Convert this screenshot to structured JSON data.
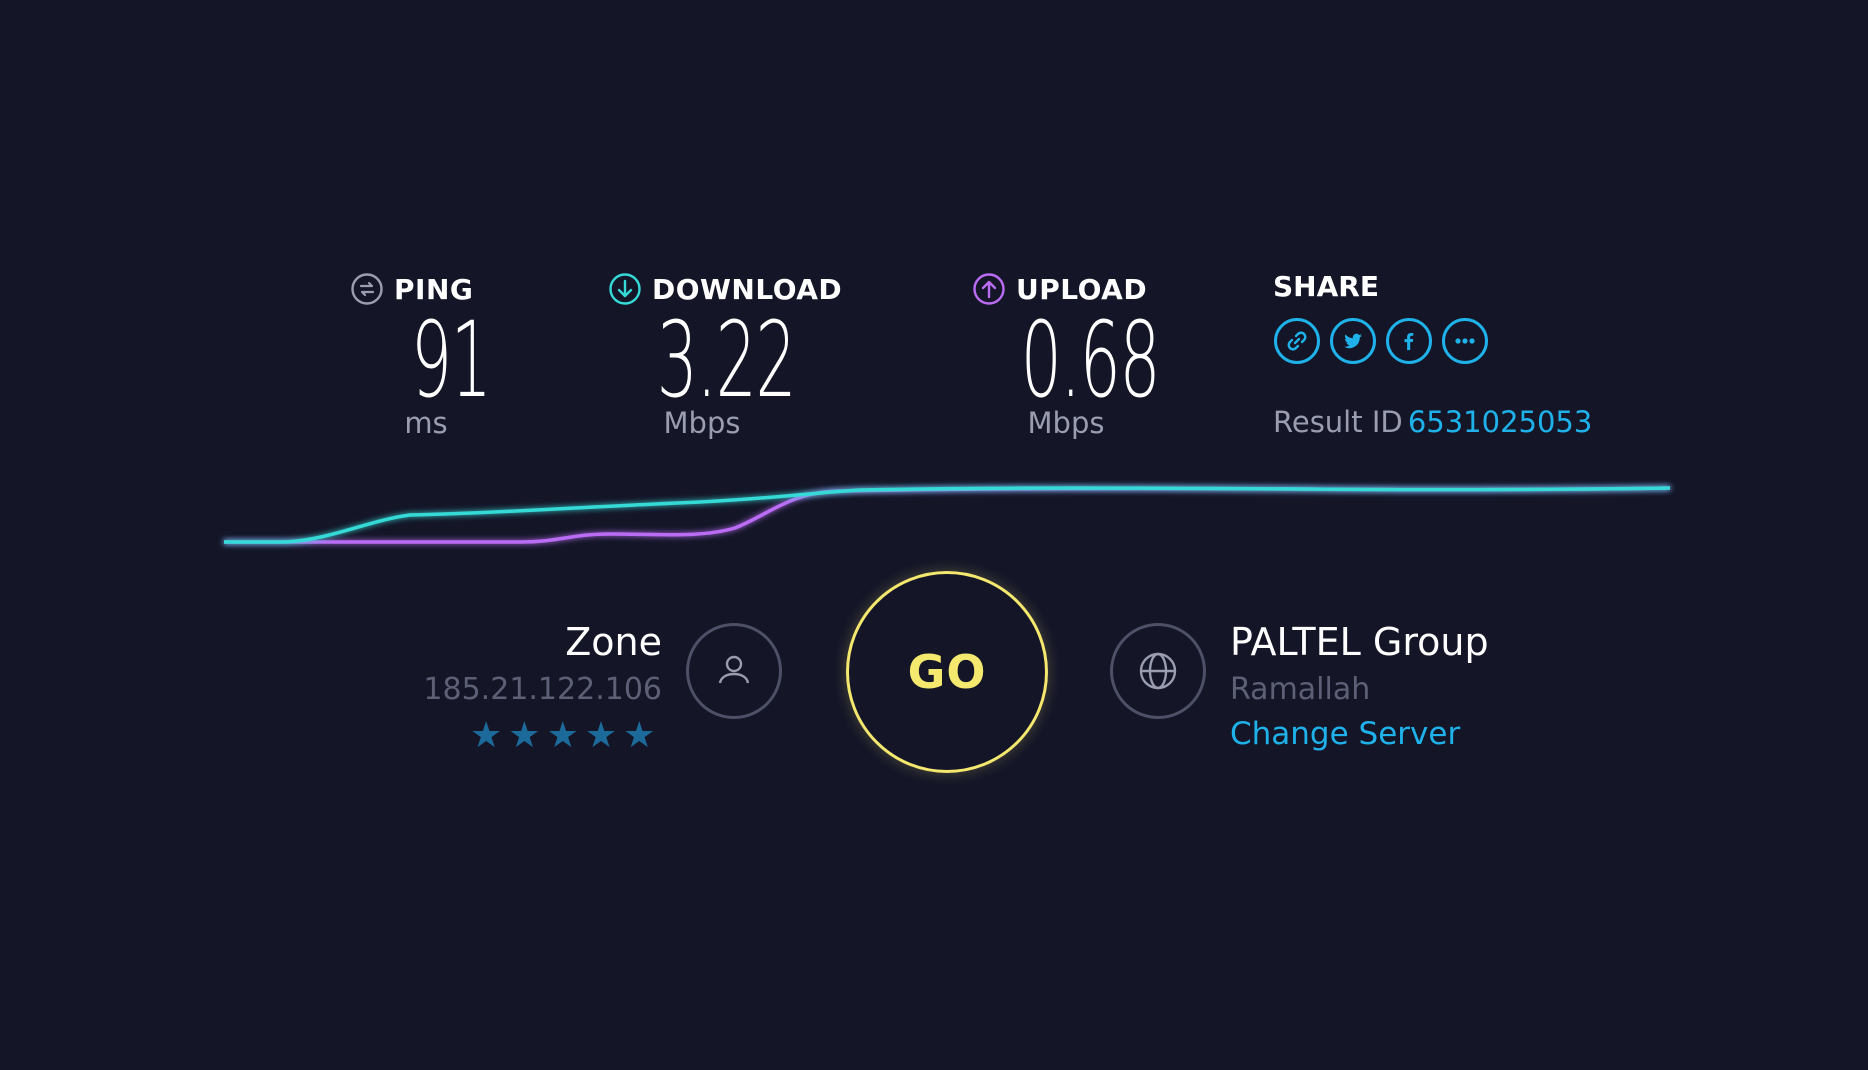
{
  "metrics": {
    "ping": {
      "label": "PING",
      "value": "91",
      "unit": "ms",
      "icon": "ping-icon",
      "color": "#9a9db0"
    },
    "download": {
      "label": "DOWNLOAD",
      "value": "3.22",
      "unit": "Mbps",
      "icon": "download-arrow-icon",
      "color": "#35d9d6"
    },
    "upload": {
      "label": "UPLOAD",
      "value": "0.68",
      "unit": "Mbps",
      "icon": "upload-arrow-icon",
      "color": "#bb6cf5"
    }
  },
  "share": {
    "label": "SHARE",
    "buttons": [
      {
        "icon": "link-icon"
      },
      {
        "icon": "twitter-icon"
      },
      {
        "icon": "facebook-icon"
      },
      {
        "icon": "more-icon"
      }
    ],
    "result_label": "Result ID",
    "result_id": "6531025053"
  },
  "graph": {
    "download_color": "#35d9d6",
    "upload_color": "#bb6cf5"
  },
  "client": {
    "name": "Zone",
    "ip": "185.21.122.106",
    "rating_stars": 5,
    "rating_max": 5,
    "icon": "user-icon"
  },
  "go_button": {
    "label": "GO",
    "color": "#f4e86e"
  },
  "server": {
    "name": "PALTEL Group",
    "location": "Ramallah",
    "change_label": "Change Server",
    "icon": "globe-icon"
  },
  "colors": {
    "background": "#141628",
    "accent": "#1fb2ea",
    "muted": "#9a9db0"
  }
}
